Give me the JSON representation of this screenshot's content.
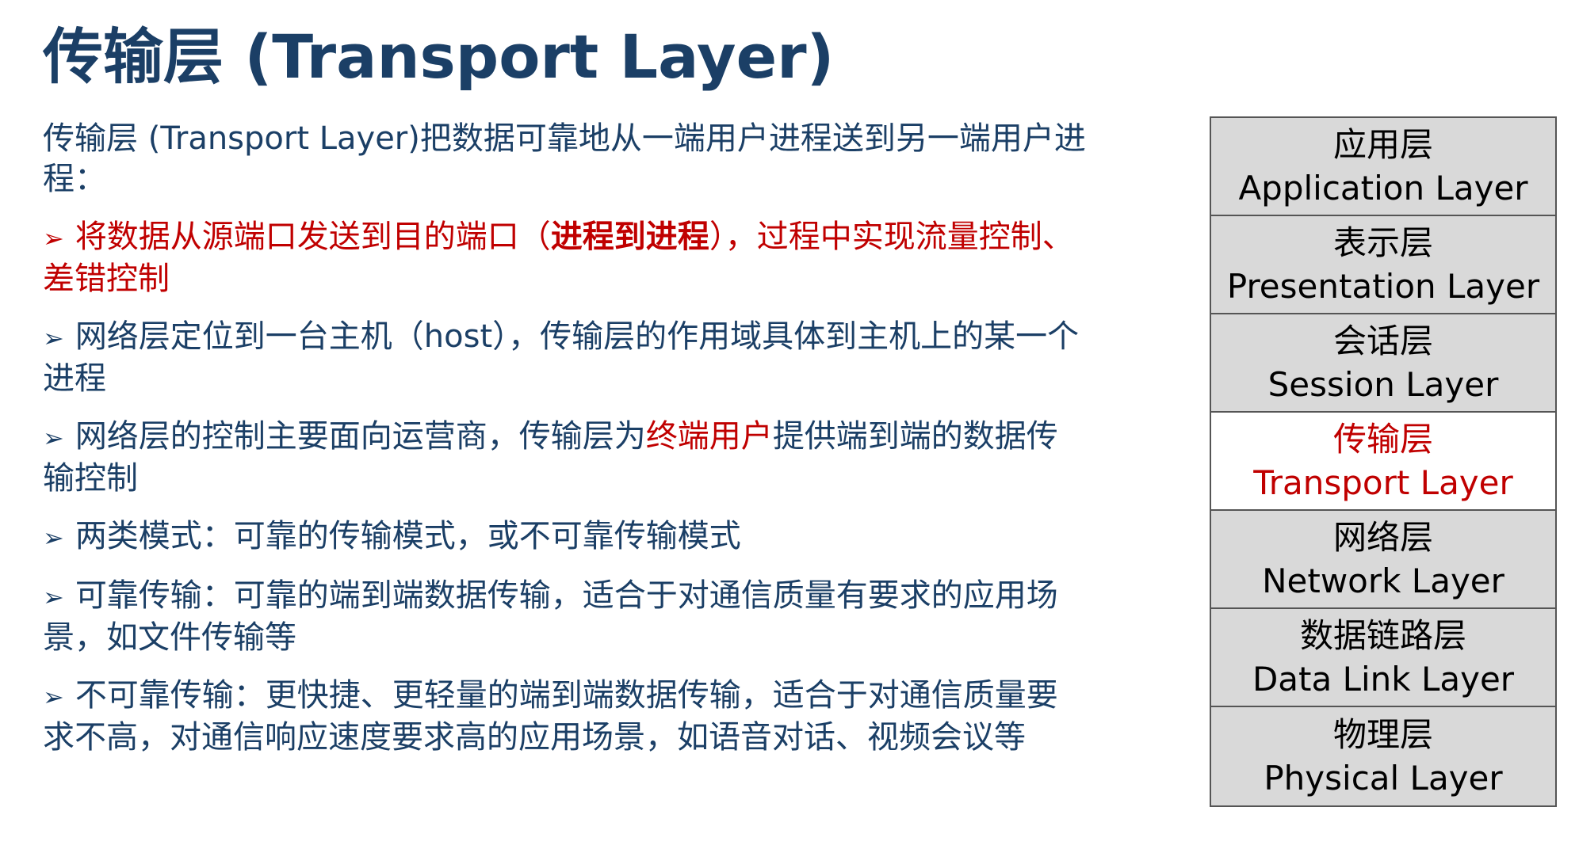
{
  "title": "传输层 (Transport Layer)",
  "intro": "传输层 (Transport Layer)把数据可靠地从一端用户进程送到另一端用户进程：",
  "bullet_arrow": "➢",
  "bullets": {
    "b1": {
      "part1": "将数据从源端口发送到目的端口（",
      "bold": "进程到进程",
      "part2": "），过程中实现流量控制、差错控制"
    },
    "b2": {
      "text": "网络层定位到一台主机（host），传输层的作用域具体到主机上的某一个进程"
    },
    "b3": {
      "part1": "网络层的控制主要面向运营商，传输层为",
      "red": "终端用户",
      "part2": "提供端到端的数据传输控制"
    },
    "b4": {
      "text": "两类模式：可靠的传输模式，或不可靠传输模式"
    },
    "b5": {
      "text": "可靠传输：可靠的端到端数据传输，适合于对通信质量有要求的应用场景，如文件传输等"
    },
    "b6": {
      "text": "不可靠传输：更快捷、更轻量的端到端数据传输，适合于对通信质量要求不高，对通信响应速度要求高的应用场景，如语音对话、视频会议等"
    }
  },
  "osi_layers": [
    {
      "cn": "应用层",
      "en": "Application Layer"
    },
    {
      "cn": "表示层",
      "en": "Presentation Layer"
    },
    {
      "cn": "会话层",
      "en": "Session Layer"
    },
    {
      "cn": "传输层",
      "en": "Transport Layer"
    },
    {
      "cn": "网络层",
      "en": "Network Layer"
    },
    {
      "cn": "数据链路层",
      "en": "Data Link Layer"
    },
    {
      "cn": "物理层",
      "en": "Physical Layer"
    }
  ],
  "colors": {
    "title": "#1b3f66",
    "body": "#1b3f66",
    "highlight": "#c00000",
    "layer_bg": "#d9d9d9",
    "layer_active_bg": "#ffffff"
  }
}
